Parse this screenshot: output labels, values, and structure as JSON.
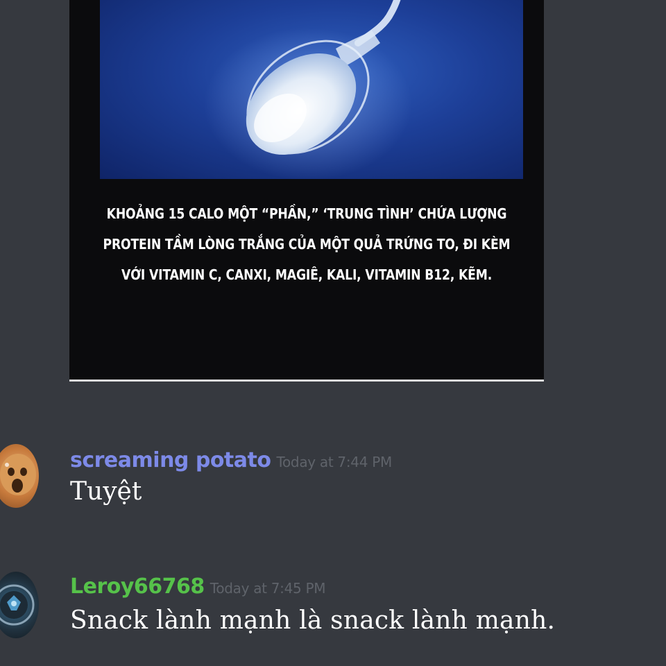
{
  "embed": {
    "caption_lines": [
      "KHOẢNG 15 CALO MỘT “PHẦN,” ‘TRUNG TÌNH’ CHỨA LƯỢNG",
      "PROTEIN TẦM LÒNG TRẮNG CỦA  MỘT QUẢ TRỨNG TO, ĐI KÈM",
      "VỚI VITAMIN C, CANXI, MAGIÊ,  KALI, VITAMIN B12, KẼM."
    ],
    "photo_icon": "sperm-cell-photo"
  },
  "messages": [
    {
      "username": "screaming potato",
      "timestamp": "Today at 7:44 PM",
      "text": "Tuyệt",
      "username_color": "#7d8ae8"
    },
    {
      "username": "Leroy66768",
      "timestamp": "Today at 7:45 PM",
      "text": "Snack lành mạnh là snack lành mạnh.",
      "username_color": "#56c24a"
    }
  ],
  "theme": {
    "background": "#36393f",
    "timestamp_color": "#5f636a"
  }
}
